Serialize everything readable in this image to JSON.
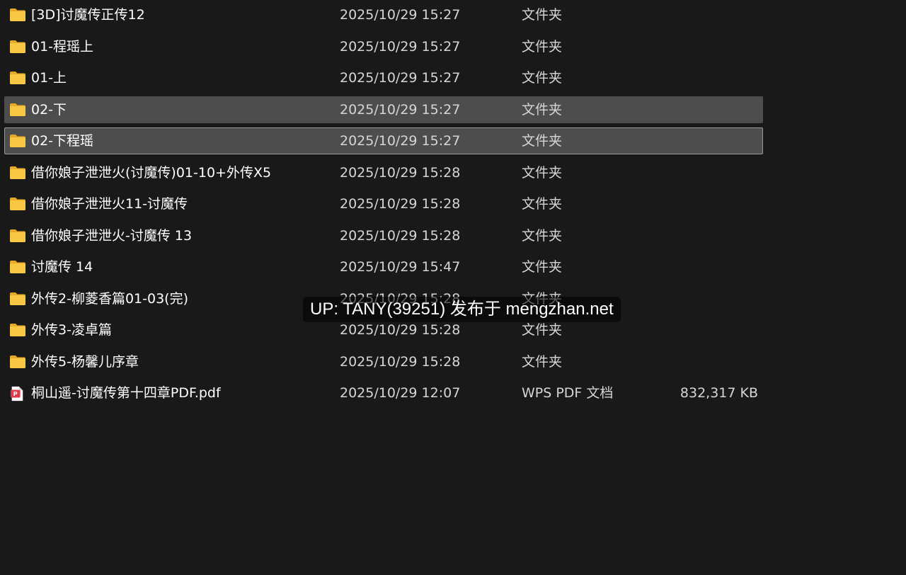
{
  "files": [
    {
      "name": "[3D]讨魔传正传12",
      "date": "2025/10/29 15:27",
      "type": "文件夹",
      "size": "",
      "icon": "folder-icon",
      "state": ""
    },
    {
      "name": "01-程瑶上",
      "date": "2025/10/29 15:27",
      "type": "文件夹",
      "size": "",
      "icon": "folder-icon",
      "state": ""
    },
    {
      "name": "01-上",
      "date": "2025/10/29 15:27",
      "type": "文件夹",
      "size": "",
      "icon": "folder-icon",
      "state": ""
    },
    {
      "name": "02-下",
      "date": "2025/10/29 15:27",
      "type": "文件夹",
      "size": "",
      "icon": "folder-icon",
      "state": "selected"
    },
    {
      "name": "02-下程瑶",
      "date": "2025/10/29 15:27",
      "type": "文件夹",
      "size": "",
      "icon": "folder-icon",
      "state": "focused"
    },
    {
      "name": "借你娘子泄泄火(讨魔传)01-10+外传X5",
      "date": "2025/10/29 15:28",
      "type": "文件夹",
      "size": "",
      "icon": "folder-icon",
      "state": ""
    },
    {
      "name": "借你娘子泄泄火11-讨魔传",
      "date": "2025/10/29 15:28",
      "type": "文件夹",
      "size": "",
      "icon": "folder-icon",
      "state": ""
    },
    {
      "name": "借你娘子泄泄火-讨魔传 13",
      "date": "2025/10/29 15:28",
      "type": "文件夹",
      "size": "",
      "icon": "folder-icon",
      "state": ""
    },
    {
      "name": "讨魔传 14",
      "date": "2025/10/29 15:47",
      "type": "文件夹",
      "size": "",
      "icon": "folder-icon",
      "state": ""
    },
    {
      "name": "外传2-柳菱香篇01-03(完)",
      "date": "2025/10/29 15:28",
      "type": "文件夹",
      "size": "",
      "icon": "folder-icon",
      "state": ""
    },
    {
      "name": "外传3-凌卓篇",
      "date": "2025/10/29 15:28",
      "type": "文件夹",
      "size": "",
      "icon": "folder-icon",
      "state": ""
    },
    {
      "name": "外传5-杨馨儿序章",
      "date": "2025/10/29 15:28",
      "type": "文件夹",
      "size": "",
      "icon": "folder-icon",
      "state": ""
    },
    {
      "name": "桐山遥-讨魔传第十四章PDF.pdf",
      "date": "2025/10/29 12:07",
      "type": "WPS PDF 文档",
      "size": "832,317 KB",
      "icon": "pdf-file-icon",
      "state": ""
    }
  ],
  "watermark": "UP: TANY(39251) 发布于 mengzhan.net",
  "colors": {
    "background": "#191919",
    "selected_row": "#4d4d4d",
    "folder_yellow": "#f8c744",
    "pdf_red": "#e0394a"
  }
}
